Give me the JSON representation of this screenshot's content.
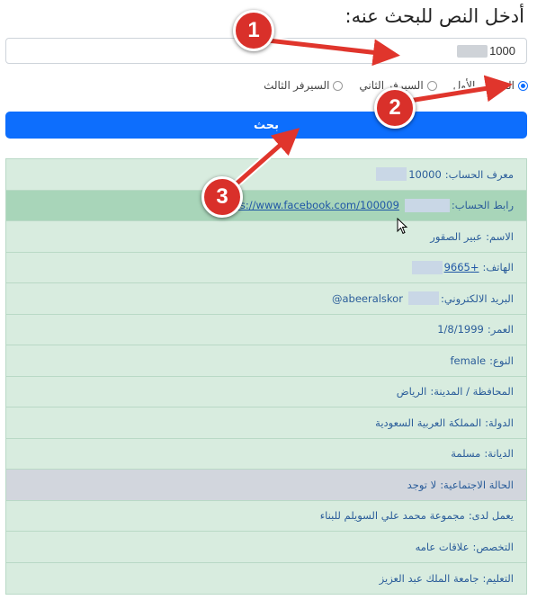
{
  "page": {
    "title": "أدخل النص للبحث عنه:",
    "search_value": "1000",
    "search_button_label": "بحث"
  },
  "servers": [
    {
      "label": "السيرفر الأول",
      "checked": true
    },
    {
      "label": "السيرفر الثاني",
      "checked": false
    },
    {
      "label": "السيرفر الثالث",
      "checked": false
    }
  ],
  "results": [
    {
      "label": "معرف الحساب:",
      "value": "10000"
    },
    {
      "label": "رابط الحساب:",
      "value": "https://www.facebook.com/100009"
    },
    {
      "label": "الاسم:",
      "value": "عبير الصقور"
    },
    {
      "label": "الهاتف:",
      "value": "+9665"
    },
    {
      "label": "البريد الالكتروني:",
      "value": "abeeralskor@"
    },
    {
      "label": "العمر:",
      "value": "1/8/1999"
    },
    {
      "label": "النوع:",
      "value": "female"
    },
    {
      "label": "المحافظة / المدينة:",
      "value": "الرياض"
    },
    {
      "label": "الدولة:",
      "value": "المملكة العربية السعودية"
    },
    {
      "label": "الديانة:",
      "value": "مسلمة"
    },
    {
      "label": "الحالة الاجتماعية:",
      "value": "لا توجد"
    },
    {
      "label": "يعمل لدى:",
      "value": "مجموعة محمد علي السويلم للبناء"
    },
    {
      "label": "التخصص:",
      "value": "علاقات عامه"
    },
    {
      "label": "التعليم:",
      "value": "جامعة الملك عبد العزيز"
    }
  ],
  "annotations": [
    {
      "number": "1"
    },
    {
      "number": "2"
    },
    {
      "number": "3"
    }
  ],
  "colors": {
    "primary": "#0d6efd",
    "row_bg": "#d8ecdf",
    "row_highlight": "#a8d5b9",
    "row_gray": "#d2d6dd",
    "badge": "#d9302a",
    "link": "#1f56a6"
  }
}
